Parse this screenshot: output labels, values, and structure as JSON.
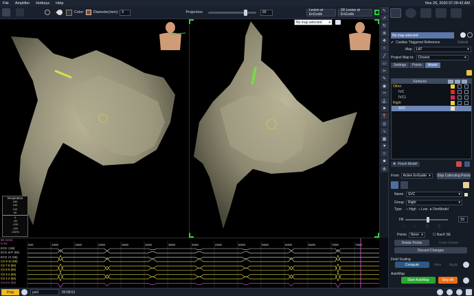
{
  "menu": {
    "items": [
      "File",
      "Amplifier",
      "Hotkeys",
      "Help"
    ],
    "datetime": "Nov 26, 2020 07:28:42 AM"
  },
  "toolbar": {
    "color_label": "Color:",
    "diameter_label": "Diameter(mm):",
    "diameter_value": "5",
    "projection_label": "Projection",
    "projection_value": "20",
    "lesion_btn": "Lesion at EnGuide",
    "lesion3d_btn": "3D Lesion at EnGuide",
    "projection_level": 0.8
  },
  "viewport": {
    "map_select": "No map selected",
    "resp_title": "Respiration",
    "resp_values": [
      "250",
      "150",
      "100",
      "50",
      "0",
      "-50",
      "-100",
      "-150",
      "-200%"
    ]
  },
  "right_panel": {
    "map_label": "No map selected",
    "cardiac_triggered": "Cardiac Triggered Reference",
    "unlock": "Unlock",
    "map_field_label": "Map",
    "map_field_value": "LAT",
    "project_label": "Project Map to:",
    "project_value": "Closest",
    "tabs": [
      "Settings",
      "Points",
      "Model"
    ],
    "surfaces_header": "Surfaces",
    "surfaces": [
      {
        "name": "Other",
        "group": true,
        "color": "#f2d13a"
      },
      {
        "name": "IVC",
        "group": false,
        "color": "#e02a2a"
      },
      {
        "name": "IVC1",
        "group": false,
        "color": "#d9245e"
      },
      {
        "name": "Right",
        "group": true,
        "color": "#f2d13a"
      },
      {
        "name": "SVC",
        "group": false,
        "color": "#e8e4b8",
        "selected": true
      }
    ],
    "finish_model": "Finish Model",
    "from_label": "From",
    "from_value": "Active EnGuide",
    "stop_collecting": "Stop Collecting Points",
    "name_label": "Name",
    "name_value": "SVC",
    "group_label": "Group",
    "group_value": "Right",
    "type_label": "Type",
    "type_high": "High",
    "type_low": "Low",
    "type_onemodel": "OneModel",
    "fill_label": "Fill",
    "fill_value": "53",
    "fill_level": 0.53,
    "points_label": "Points",
    "points_value": "None",
    "navx_se": "NavX SE",
    "delete_points": "Delete Points",
    "undo_delete": "Undo Delete",
    "discard_changes": "Discard Changes",
    "field_scaling": "Field Scaling",
    "compute": "Compute",
    "auto": "Auto",
    "apply": "Apply",
    "automap": "AutoMap",
    "start_automap": "Start AutoMap",
    "stop_all": "Stop All",
    "colors": {
      "accent": "#2c5a86",
      "green": "#27a82e",
      "orange": "#f26b0f",
      "selected_row": "#6d87b8"
    }
  },
  "ecg": {
    "scale_label": "50 mm/s",
    "scale_sub": "0 ms",
    "time_ticks": [
      "500",
      "1000",
      "1500",
      "2000",
      "2500",
      "3000",
      "3500",
      "4000",
      "4500",
      "5000",
      "5500",
      "6000",
      "6500",
      "7000",
      "7500"
    ],
    "channels": [
      {
        "label": "ECG I (55)",
        "color": "#d9d9d9"
      },
      {
        "label": "ECG aVF (55)",
        "color": "#d9d9d9"
      },
      {
        "label": "ECG V1 (55)",
        "color": "#d9d9d9"
      },
      {
        "label": "CS 9-10 (55)",
        "color": "#f0e84a"
      },
      {
        "label": "CS 7-8 (55)",
        "color": "#f0e84a"
      },
      {
        "label": "CS 5-6 (55)",
        "color": "#f0e84a"
      },
      {
        "label": "CS 3-4 (55)",
        "color": "#f0e84a"
      },
      {
        "label": "CS 1-2 (55)",
        "color": "#f0e84a"
      },
      {
        "label": "CS d-2 (55)",
        "color": "#e060e0"
      }
    ]
  },
  "statusbar": {
    "mode": "Prep",
    "patient": "pat1",
    "time": "00:08:51"
  }
}
